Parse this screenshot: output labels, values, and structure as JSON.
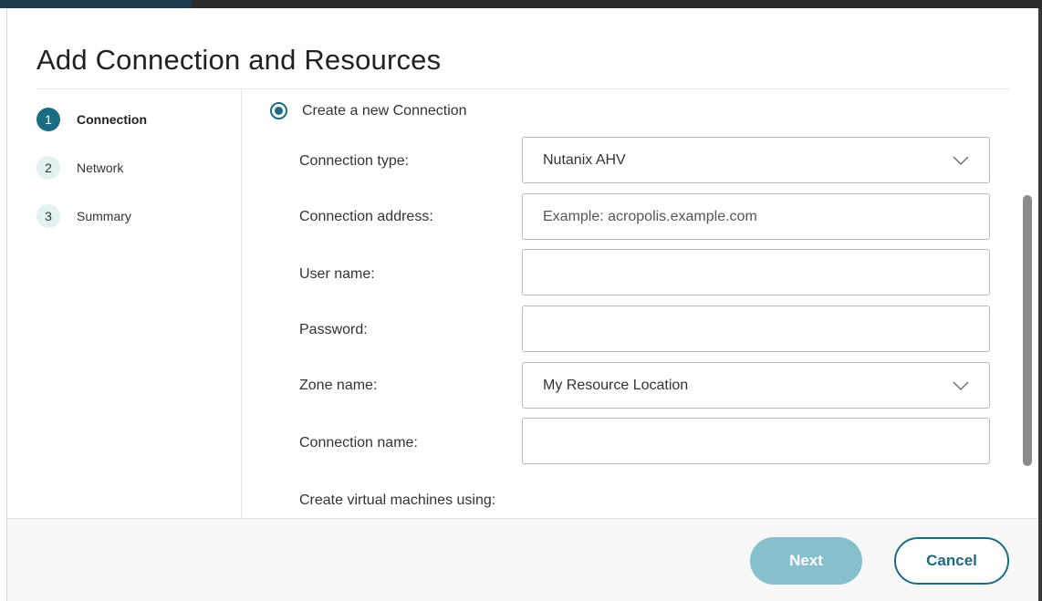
{
  "dialog": {
    "title": "Add Connection and Resources"
  },
  "steps": [
    {
      "number": "1",
      "label": "Connection",
      "active": true
    },
    {
      "number": "2",
      "label": "Network",
      "active": false
    },
    {
      "number": "3",
      "label": "Summary",
      "active": false
    }
  ],
  "connection_option": {
    "label": "Create a new Connection",
    "selected": true
  },
  "form": {
    "connection_type": {
      "label": "Connection type:",
      "value": "Nutanix AHV"
    },
    "connection_address": {
      "label": "Connection address:",
      "value": "",
      "placeholder": "Example: acropolis.example.com"
    },
    "user_name": {
      "label": "User name:",
      "value": ""
    },
    "password": {
      "label": "Password:",
      "value": ""
    },
    "zone_name": {
      "label": "Zone name:",
      "value": "My Resource Location"
    },
    "connection_name": {
      "label": "Connection name:",
      "value": ""
    },
    "create_vms_label": "Create virtual machines using:"
  },
  "footer": {
    "next_label": "Next",
    "cancel_label": "Cancel"
  },
  "colors": {
    "accent": "#1b6c82",
    "accent_disabled": "#86c0cc",
    "step_inactive_bg": "#e3f1f3"
  },
  "icons": {
    "dropdown": "chevron-down-icon"
  }
}
